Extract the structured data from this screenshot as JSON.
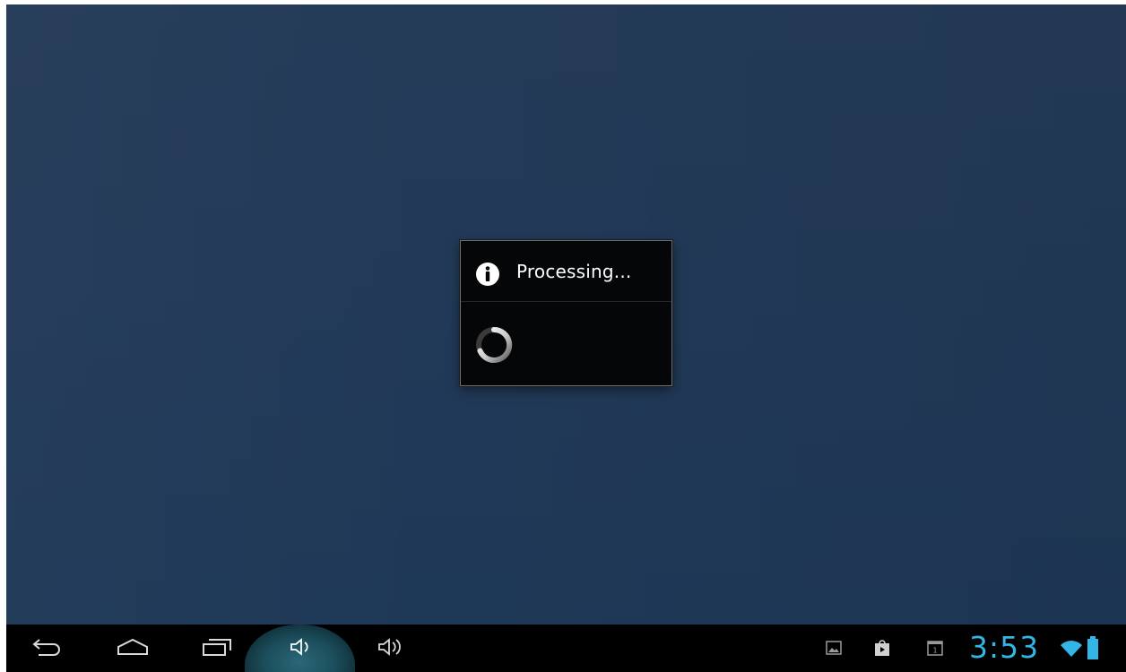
{
  "dialog": {
    "title": "Processing...",
    "icon": "info-icon"
  },
  "navigation": {
    "back": "back-icon",
    "home": "home-icon",
    "recents": "recent-apps-icon",
    "volume_down": "volume-down-icon",
    "volume_up": "volume-up-icon"
  },
  "status": {
    "clock": "3:53",
    "notifications": [
      "gallery-icon",
      "play-store-icon",
      "calendar-icon"
    ],
    "wifi": "wifi-icon",
    "battery": "battery-icon"
  },
  "colors": {
    "accent": "#33b5e5",
    "wallpaper": "#223a58",
    "dialog_bg": "#050607",
    "systembar_bg": "#000000"
  }
}
